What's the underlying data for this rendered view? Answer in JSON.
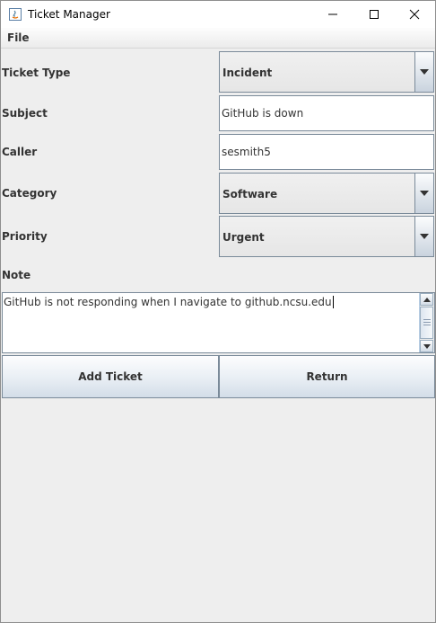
{
  "window": {
    "title": "Ticket Manager",
    "controls": {
      "minimize": "minimize-icon",
      "maximize": "maximize-icon",
      "close": "close-icon"
    }
  },
  "menubar": {
    "items": [
      {
        "label": "File"
      }
    ]
  },
  "form": {
    "ticket_type": {
      "label": "Ticket Type",
      "value": "Incident"
    },
    "subject": {
      "label": "Subject",
      "value": "GitHub is down"
    },
    "caller": {
      "label": "Caller",
      "value": "sesmith5"
    },
    "category": {
      "label": "Category",
      "value": "Software"
    },
    "priority": {
      "label": "Priority",
      "value": "Urgent"
    },
    "note": {
      "label": "Note",
      "value": "GitHub is not responding when I navigate to github.ncsu.edu"
    }
  },
  "buttons": {
    "add_ticket": "Add Ticket",
    "return": "Return"
  },
  "colors": {
    "border": "#7a8a99",
    "background": "#eeeeee",
    "text": "#333333"
  }
}
